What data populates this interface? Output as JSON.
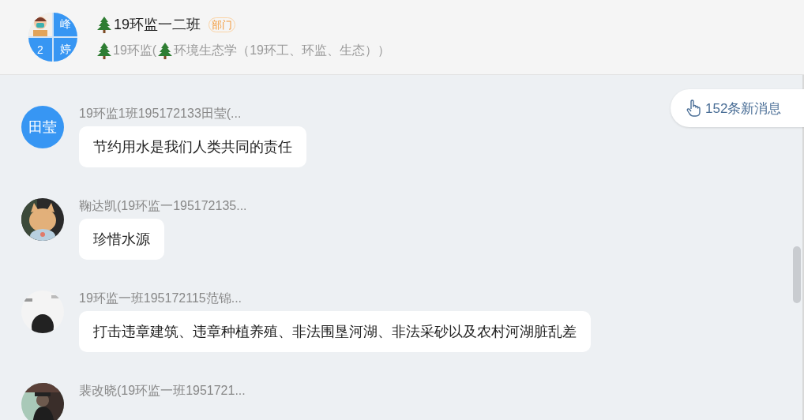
{
  "header": {
    "group_avatar": {
      "cells": [
        "峰",
        "2",
        "婷"
      ]
    },
    "title": "19环监一二班",
    "badge": "部门",
    "subtitle_parts": [
      "19环监(",
      "环境生态学（19环工、环监、生态））"
    ]
  },
  "messages": [
    {
      "sender": "19环监1班195172133田莹(...",
      "avatar": {
        "kind": "initials",
        "text": "田莹"
      },
      "text": "节约用水是我们人类共同的责任"
    },
    {
      "sender": "鞠达凯(19环监一195172135...",
      "text": "珍惜水源"
    },
    {
      "sender": "19环监一班195172115范锦...",
      "text": "打击违章建筑、违章种植养殖、非法围垦河湖、非法采砂以及农村河湖脏乱差"
    },
    {
      "sender": "裴改晓(19环监一班1951721..."
    }
  ],
  "new_messages": "152条新消息"
}
